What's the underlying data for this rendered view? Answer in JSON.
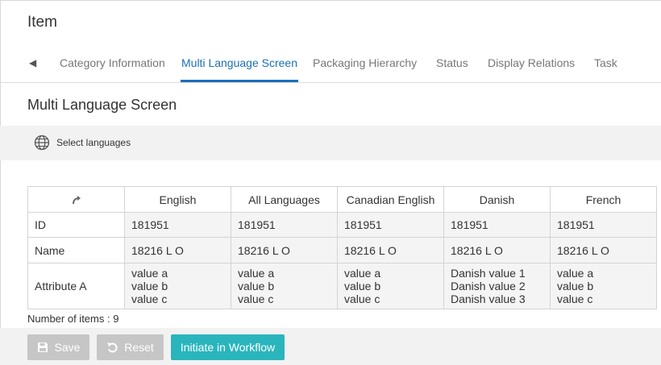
{
  "page": {
    "title": "Item"
  },
  "tabs": {
    "back_glyph": "◀",
    "items": [
      {
        "label": "Category Information",
        "active": false
      },
      {
        "label": "Multi Language Screen",
        "active": true
      },
      {
        "label": "Packaging Hierarchy",
        "active": false
      },
      {
        "label": "Status",
        "active": false
      },
      {
        "label": "Display Relations",
        "active": false
      },
      {
        "label": "Task",
        "active": false
      }
    ]
  },
  "section": {
    "title": "Multi Language Screen"
  },
  "toolbar": {
    "select_languages_label": "Select languages",
    "icon": "globe-icon"
  },
  "grid": {
    "corner_icon": "refresh-arrow-icon",
    "columns": [
      "English",
      "All Languages",
      "Canadian English",
      "Danish",
      "French"
    ],
    "rows": [
      {
        "label": "ID",
        "values": [
          "181951",
          "181951",
          "181951",
          "181951",
          "181951"
        ]
      },
      {
        "label": "Name",
        "values": [
          "18216 L O",
          "18216 L O",
          "18216 L O",
          "18216 L O",
          "18216 L O"
        ]
      },
      {
        "label": "Attribute A",
        "values": [
          [
            "value a",
            "value b",
            "value c"
          ],
          [
            "value a",
            "value b",
            "value c"
          ],
          [
            "value a",
            "value b",
            "value c"
          ],
          [
            "Danish value 1",
            "Danish value 2",
            "Danish value 3"
          ],
          [
            "value a",
            "value b",
            "value c"
          ]
        ]
      }
    ]
  },
  "footer": {
    "items_count": "Number of items : 9",
    "save_label": "Save",
    "reset_label": "Reset",
    "workflow_label": "Initiate in Workflow"
  },
  "colors": {
    "accent": "#1a6fb5",
    "workflow_button": "#2ab5bd",
    "disabled_button": "#c6c6c6",
    "toolbar_bg": "#f2f2f2"
  }
}
